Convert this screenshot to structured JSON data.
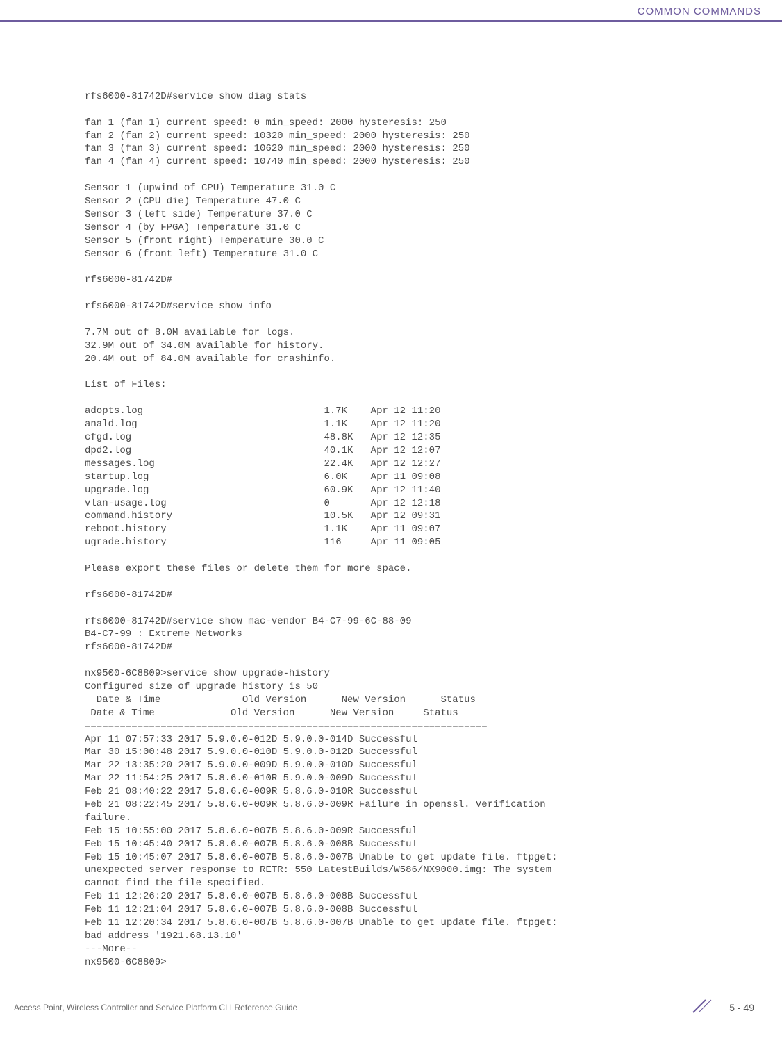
{
  "header": {
    "title": "COMMON COMMANDS"
  },
  "terminal": {
    "block1_cmd": "rfs6000-81742D#service show diag stats",
    "block1_body": "fan 1 (fan 1) current speed: 0 min_speed: 2000 hysteresis: 250\nfan 2 (fan 2) current speed: 10320 min_speed: 2000 hysteresis: 250\nfan 3 (fan 3) current speed: 10620 min_speed: 2000 hysteresis: 250\nfan 4 (fan 4) current speed: 10740 min_speed: 2000 hysteresis: 250",
    "block1_sensors": "Sensor 1 (upwind of CPU) Temperature 31.0 C\nSensor 2 (CPU die) Temperature 47.0 C\nSensor 3 (left side) Temperature 37.0 C\nSensor 4 (by FPGA) Temperature 31.0 C\nSensor 5 (front right) Temperature 30.0 C\nSensor 6 (front left) Temperature 31.0 C",
    "block1_prompt": "rfs6000-81742D#",
    "block2_cmd": "rfs6000-81742D#service show info",
    "block2_body": "7.7M out of 8.0M available for logs.\n32.9M out of 34.0M available for history.\n20.4M out of 84.0M available for crashinfo.",
    "block2_list_header": "List of Files:",
    "block2_files": "adopts.log                               1.7K    Apr 12 11:20\nanald.log                                1.1K    Apr 12 11:20\ncfgd.log                                 48.8K   Apr 12 12:35\ndpd2.log                                 40.1K   Apr 12 12:07\nmessages.log                             22.4K   Apr 12 12:27\nstartup.log                              6.0K    Apr 11 09:08\nupgrade.log                              60.9K   Apr 12 11:40\nvlan-usage.log                           0       Apr 12 12:18\ncommand.history                          10.5K   Apr 12 09:31\nreboot.history                           1.1K    Apr 11 09:07\nugrade.history                           116     Apr 11 09:05",
    "block2_note": "Please export these files or delete them for more space.",
    "block2_prompt": "rfs6000-81742D#",
    "block3_cmd": "rfs6000-81742D#service show mac-vendor B4-C7-99-6C-88-09\nB4-C7-99 : Extreme Networks\nrfs6000-81742D#",
    "block4": "nx9500-6C8809>service show upgrade-history\nConfigured size of upgrade history is 50\n  Date & Time              Old Version      New Version      Status\n Date & Time             Old Version      New Version     Status\n=====================================================================\nApr 11 07:57:33 2017 5.9.0.0-012D 5.9.0.0-014D Successful\nMar 30 15:00:48 2017 5.9.0.0-010D 5.9.0.0-012D Successful\nMar 22 13:35:20 2017 5.9.0.0-009D 5.9.0.0-010D Successful\nMar 22 11:54:25 2017 5.8.6.0-010R 5.9.0.0-009D Successful\nFeb 21 08:40:22 2017 5.8.6.0-009R 5.8.6.0-010R Successful\nFeb 21 08:22:45 2017 5.8.6.0-009R 5.8.6.0-009R Failure in openssl. Verification \nfailure.\nFeb 15 10:55:00 2017 5.8.6.0-007B 5.8.6.0-009R Successful\nFeb 15 10:45:40 2017 5.8.6.0-007B 5.8.6.0-008B Successful\nFeb 15 10:45:07 2017 5.8.6.0-007B 5.8.6.0-007B Unable to get update file. ftpget: \nunexpected server response to RETR: 550 LatestBuilds/W586/NX9000.img: The system \ncannot find the file specified.\nFeb 11 12:26:20 2017 5.8.6.0-007B 5.8.6.0-008B Successful\nFeb 11 12:21:04 2017 5.8.6.0-007B 5.8.6.0-008B Successful\nFeb 11 12:20:34 2017 5.8.6.0-007B 5.8.6.0-007B Unable to get update file. ftpget: \nbad address '1921.68.13.10'\n---More--\nnx9500-6C8809>"
  },
  "footer": {
    "left": "Access Point, Wireless Controller and Service Platform CLI Reference Guide",
    "page": "5 - 49"
  }
}
